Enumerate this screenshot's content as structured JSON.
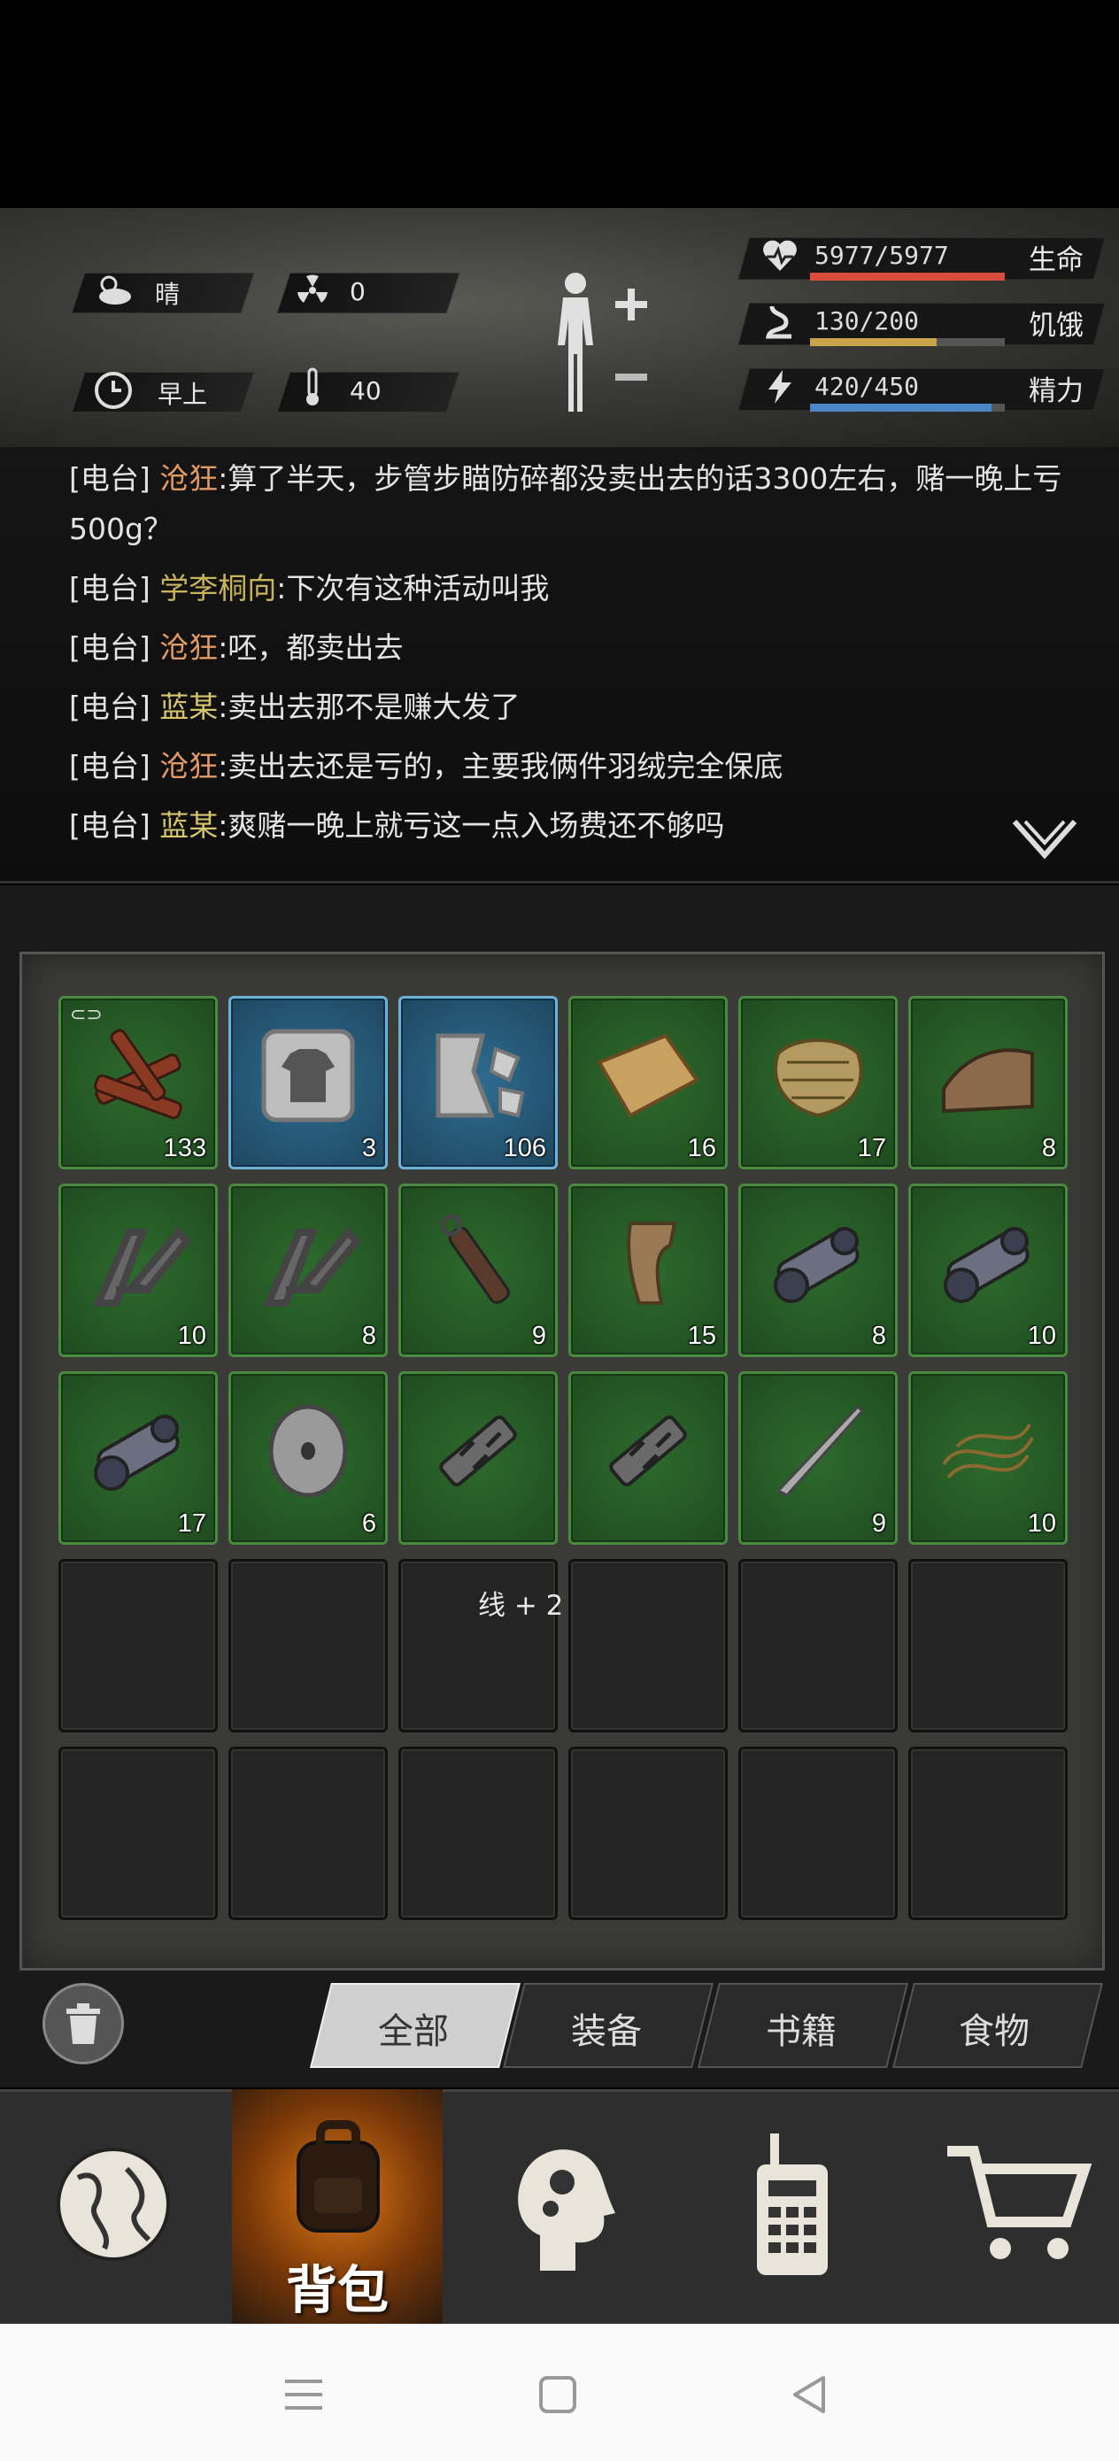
{
  "hud": {
    "weather": "晴",
    "radiation": "0",
    "time_of_day": "早上",
    "temperature": "40",
    "health": {
      "text": "5977/5977",
      "label": "生命",
      "fraction": 1.0,
      "color": "#d94b3a"
    },
    "hunger": {
      "text": "130/200",
      "label": "饥饿",
      "fraction": 0.65,
      "color": "#c9a44a"
    },
    "energy": {
      "text": "420/450",
      "label": "精力",
      "fraction": 0.93,
      "color": "#4a86c8"
    }
  },
  "chat": [
    {
      "channel": "[电台]",
      "user": "沧狂",
      "text": ":算了半天，步管步瞄防碎都没卖出去的话3300左右，赌一晚上亏500g？",
      "user_class": "who-a"
    },
    {
      "channel": "[电台]",
      "user": "学李桐向",
      "text": ":下次有这种活动叫我",
      "user_class": "who-c"
    },
    {
      "channel": "[电台]",
      "user": "沧狂",
      "text": ":呸，都卖出去",
      "user_class": "who-a"
    },
    {
      "channel": "[电台]",
      "user": "蓝某",
      "text": ":卖出去那不是赚大发了",
      "user_class": "who-b"
    },
    {
      "channel": "[电台]",
      "user": "沧狂",
      "text": ":卖出去还是亏的，主要我俩件羽绒完全保底",
      "user_class": "who-a"
    },
    {
      "channel": "[电台]",
      "user": "蓝某",
      "text": ":爽赌一晚上就亏这一点入场费还不够吗",
      "user_class": "who-b"
    }
  ],
  "inventory": {
    "items": [
      {
        "icon": "firewood-icon",
        "count": "133",
        "rarity": "green"
      },
      {
        "icon": "shirt-plate-icon",
        "count": "3",
        "rarity": "blue"
      },
      {
        "icon": "broken-plate-icon",
        "count": "106",
        "rarity": "blue"
      },
      {
        "icon": "leather-sheet-icon",
        "count": "16",
        "rarity": "green"
      },
      {
        "icon": "chainmail-icon",
        "count": "17",
        "rarity": "green"
      },
      {
        "icon": "leather-piece-icon",
        "count": "8",
        "rarity": "green"
      },
      {
        "icon": "foregrip-icon",
        "count": "10",
        "rarity": "green"
      },
      {
        "icon": "foregrip-icon",
        "count": "8",
        "rarity": "green"
      },
      {
        "icon": "grip-tube-icon",
        "count": "9",
        "rarity": "green"
      },
      {
        "icon": "pistol-grip-icon",
        "count": "15",
        "rarity": "green"
      },
      {
        "icon": "scope-icon",
        "count": "8",
        "rarity": "green"
      },
      {
        "icon": "scope-icon",
        "count": "10",
        "rarity": "green"
      },
      {
        "icon": "scope-icon",
        "count": "17",
        "rarity": "green"
      },
      {
        "icon": "washer-icon",
        "count": "6",
        "rarity": "green"
      },
      {
        "icon": "muzzle-brake-icon",
        "count": "",
        "rarity": "green"
      },
      {
        "icon": "muzzle-brake-icon",
        "count": "",
        "rarity": "green"
      },
      {
        "icon": "blade-icon",
        "count": "9",
        "rarity": "green"
      },
      {
        "icon": "rope-icon",
        "count": "10",
        "rarity": "green"
      }
    ],
    "floating_text": "线 + 2"
  },
  "tabs": [
    "全部",
    "装备",
    "书籍",
    "食物"
  ],
  "nav": {
    "bag_label": "背包"
  }
}
